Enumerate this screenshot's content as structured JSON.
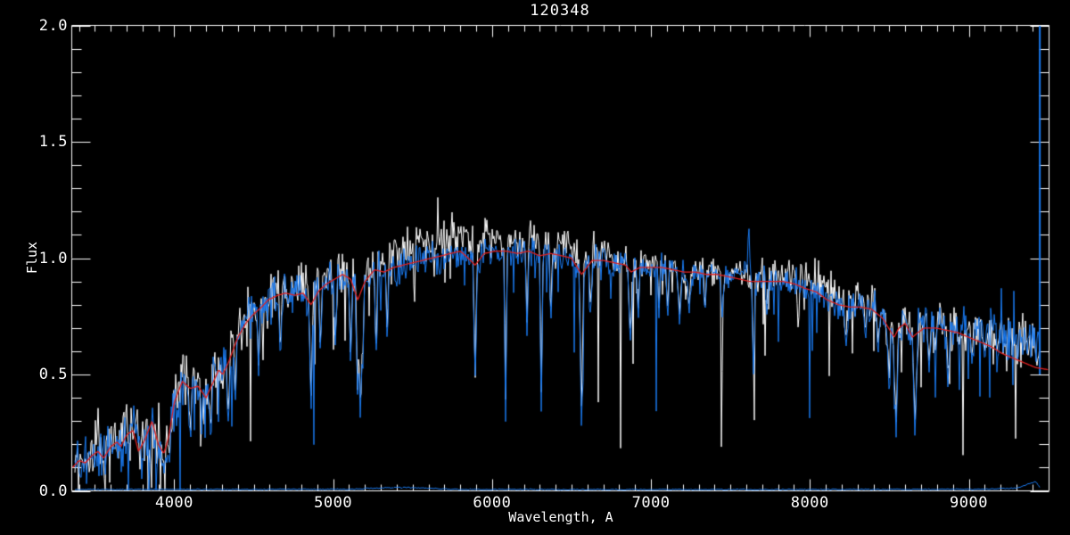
{
  "chart_data": {
    "type": "line",
    "title": "120348",
    "xlabel": "Wavelength, A",
    "ylabel": "Flux",
    "xlim": [
      3355,
      9505
    ],
    "ylim": [
      0.0,
      2.0
    ],
    "x_major_ticks": [
      4000,
      5000,
      6000,
      7000,
      8000,
      9000
    ],
    "x_tick_labels": [
      "4000",
      "5000",
      "6000",
      "7000",
      "8000",
      "9000"
    ],
    "x_minor_step": 100,
    "y_major_ticks": [
      0.0,
      0.5,
      1.0,
      1.5,
      2.0
    ],
    "y_tick_labels": [
      "0.0",
      "0.5",
      "1.0",
      "1.5",
      "2.0"
    ],
    "y_minor_step": 0.1,
    "grid": false,
    "legend": "none",
    "colors": {
      "background": "#000000",
      "axis": "#ffffff",
      "observed_white": "#ffffff",
      "observed_blue": "#1a7af0",
      "model_red": "#e02020"
    },
    "series": [
      {
        "name": "observed-spectrum-white",
        "color": "#ffffff",
        "style": "noisy-histogram"
      },
      {
        "name": "observed-spectrum-blue",
        "color": "#1a7af0",
        "style": "noisy-histogram"
      },
      {
        "name": "model-fit-red",
        "color": "#e02020",
        "style": "smooth-line"
      },
      {
        "name": "error-spectrum-blue",
        "color": "#1a7af0",
        "style": "near-zero-baseline"
      }
    ],
    "continuum_points": [
      [
        3360,
        0.1
      ],
      [
        3400,
        0.13
      ],
      [
        3440,
        0.12
      ],
      [
        3480,
        0.15
      ],
      [
        3520,
        0.17
      ],
      [
        3555,
        0.14
      ],
      [
        3600,
        0.19
      ],
      [
        3640,
        0.21
      ],
      [
        3665,
        0.19
      ],
      [
        3700,
        0.24
      ],
      [
        3740,
        0.26
      ],
      [
        3775,
        0.17
      ],
      [
        3815,
        0.22
      ],
      [
        3860,
        0.3
      ],
      [
        3900,
        0.2
      ],
      [
        3934,
        0.16
      ],
      [
        3965,
        0.23
      ],
      [
        4000,
        0.38
      ],
      [
        4050,
        0.47
      ],
      [
        4101,
        0.44
      ],
      [
        4150,
        0.45
      ],
      [
        4200,
        0.4
      ],
      [
        4240,
        0.46
      ],
      [
        4280,
        0.52
      ],
      [
        4305,
        0.5
      ],
      [
        4340,
        0.55
      ],
      [
        4400,
        0.66
      ],
      [
        4450,
        0.72
      ],
      [
        4500,
        0.76
      ],
      [
        4550,
        0.79
      ],
      [
        4590,
        0.82
      ],
      [
        4650,
        0.84
      ],
      [
        4700,
        0.85
      ],
      [
        4760,
        0.84
      ],
      [
        4810,
        0.85
      ],
      [
        4861,
        0.8
      ],
      [
        4910,
        0.86
      ],
      [
        4960,
        0.89
      ],
      [
        5010,
        0.91
      ],
      [
        5060,
        0.93
      ],
      [
        5110,
        0.91
      ],
      [
        5155,
        0.82
      ],
      [
        5200,
        0.9
      ],
      [
        5260,
        0.95
      ],
      [
        5320,
        0.94
      ],
      [
        5380,
        0.96
      ],
      [
        5440,
        0.97
      ],
      [
        5500,
        0.98
      ],
      [
        5560,
        0.99
      ],
      [
        5620,
        1.0
      ],
      [
        5680,
        1.01
      ],
      [
        5740,
        1.02
      ],
      [
        5800,
        1.03
      ],
      [
        5850,
        1.0
      ],
      [
        5893,
        0.97
      ],
      [
        5950,
        1.02
      ],
      [
        6020,
        1.03
      ],
      [
        6090,
        1.03
      ],
      [
        6160,
        1.02
      ],
      [
        6230,
        1.03
      ],
      [
        6300,
        1.01
      ],
      [
        6370,
        1.02
      ],
      [
        6440,
        1.01
      ],
      [
        6500,
        1.0
      ],
      [
        6563,
        0.93
      ],
      [
        6630,
        0.99
      ],
      [
        6700,
        0.99
      ],
      [
        6770,
        0.98
      ],
      [
        6840,
        0.97
      ],
      [
        6875,
        0.94
      ],
      [
        6930,
        0.96
      ],
      [
        7000,
        0.96
      ],
      [
        7070,
        0.96
      ],
      [
        7140,
        0.95
      ],
      [
        7210,
        0.94
      ],
      [
        7280,
        0.94
      ],
      [
        7350,
        0.93
      ],
      [
        7420,
        0.93
      ],
      [
        7490,
        0.92
      ],
      [
        7560,
        0.91
      ],
      [
        7620,
        0.9
      ],
      [
        7690,
        0.9
      ],
      [
        7760,
        0.9
      ],
      [
        7830,
        0.9
      ],
      [
        7900,
        0.89
      ],
      [
        7970,
        0.87
      ],
      [
        8040,
        0.855
      ],
      [
        8110,
        0.82
      ],
      [
        8180,
        0.8
      ],
      [
        8250,
        0.79
      ],
      [
        8320,
        0.79
      ],
      [
        8390,
        0.78
      ],
      [
        8460,
        0.74
      ],
      [
        8530,
        0.66
      ],
      [
        8560,
        0.7
      ],
      [
        8600,
        0.72
      ],
      [
        8645,
        0.66
      ],
      [
        8680,
        0.68
      ],
      [
        8720,
        0.7
      ],
      [
        8790,
        0.7
      ],
      [
        8860,
        0.69
      ],
      [
        8930,
        0.68
      ],
      [
        9000,
        0.66
      ],
      [
        9070,
        0.64
      ],
      [
        9140,
        0.62
      ],
      [
        9210,
        0.59
      ],
      [
        9280,
        0.57
      ],
      [
        9350,
        0.55
      ],
      [
        9420,
        0.53
      ],
      [
        9505,
        0.52
      ]
    ],
    "noise_sigma_points": [
      [
        3360,
        0.055
      ],
      [
        3700,
        0.06
      ],
      [
        4000,
        0.055
      ],
      [
        4300,
        0.05
      ],
      [
        4600,
        0.045
      ],
      [
        5000,
        0.042
      ],
      [
        5500,
        0.038
      ],
      [
        6000,
        0.032
      ],
      [
        6500,
        0.03
      ],
      [
        7000,
        0.028
      ],
      [
        7500,
        0.028
      ],
      [
        8000,
        0.032
      ],
      [
        8500,
        0.036
      ],
      [
        9000,
        0.042
      ],
      [
        9460,
        0.048
      ]
    ],
    "white_offset_points": [
      [
        3360,
        0.01
      ],
      [
        4400,
        0.015
      ],
      [
        5100,
        0.02
      ],
      [
        5300,
        0.045
      ],
      [
        5500,
        0.07
      ],
      [
        5700,
        0.08
      ],
      [
        5900,
        0.07
      ],
      [
        6100,
        0.06
      ],
      [
        6300,
        0.055
      ],
      [
        6500,
        0.05
      ],
      [
        6700,
        0.03
      ],
      [
        6900,
        0.01
      ],
      [
        7200,
        0.005
      ],
      [
        7600,
        0.015
      ],
      [
        7900,
        0.03
      ],
      [
        8100,
        0.05
      ],
      [
        8300,
        0.04
      ],
      [
        8500,
        0.015
      ],
      [
        8700,
        0.005
      ],
      [
        9000,
        0.0
      ],
      [
        9460,
        0.0
      ]
    ],
    "blue_end_offset_points": [
      [
        3360,
        0
      ],
      [
        8600,
        0
      ],
      [
        8800,
        0.02
      ],
      [
        9000,
        0.04
      ],
      [
        9100,
        0.06
      ],
      [
        9200,
        0.08
      ],
      [
        9300,
        0.09
      ],
      [
        9400,
        0.1
      ],
      [
        9460,
        0.1
      ]
    ],
    "absorption_lines": [
      [
        3934,
        0.05,
        2
      ],
      [
        3968,
        0.1,
        1.5
      ],
      [
        4101,
        0.18,
        2
      ],
      [
        4172,
        0.22,
        1.5
      ],
      [
        4227,
        0.2,
        1.5
      ],
      [
        4340,
        0.25,
        2
      ],
      [
        4383,
        0.3,
        1.5
      ],
      [
        4530,
        0.45,
        1.5
      ],
      [
        4668,
        0.52,
        1.5
      ],
      [
        4861,
        0.3,
        2
      ],
      [
        4920,
        0.55,
        1.5
      ],
      [
        5015,
        0.55,
        1.5
      ],
      [
        5110,
        0.5,
        1.5
      ],
      [
        5155,
        0.33,
        2
      ],
      [
        5172,
        0.2,
        1.5
      ],
      [
        5185,
        0.42,
        1.5
      ],
      [
        5270,
        0.52,
        1.5
      ],
      [
        5340,
        0.6,
        1.5
      ],
      [
        5893,
        0.45,
        2
      ],
      [
        6085,
        0.27,
        1.5
      ],
      [
        6220,
        0.65,
        1.5
      ],
      [
        6310,
        0.3,
        1.5
      ],
      [
        6370,
        0.68,
        1.5
      ],
      [
        6563,
        0.2,
        2
      ],
      [
        6620,
        0.7,
        1.5
      ],
      [
        6870,
        0.6,
        2.5
      ],
      [
        6920,
        0.72,
        1.5
      ],
      [
        7050,
        0.74,
        1.5
      ],
      [
        7105,
        0.7,
        1.5
      ],
      [
        7180,
        0.7,
        2.5
      ],
      [
        7240,
        0.72,
        2
      ],
      [
        7340,
        0.72,
        1.5
      ],
      [
        7450,
        0.7,
        1.5
      ],
      [
        7645,
        0.45,
        1.5
      ],
      [
        7730,
        0.72,
        1.5
      ],
      [
        8227,
        0.58,
        2
      ],
      [
        8350,
        0.6,
        1.5
      ],
      [
        8430,
        0.58,
        1.5
      ],
      [
        8498,
        0.42,
        2
      ],
      [
        8542,
        0.2,
        2.5
      ],
      [
        8662,
        0.18,
        2.5
      ],
      [
        8750,
        0.48,
        2
      ],
      [
        8790,
        0.52,
        1.5
      ],
      [
        8870,
        0.42,
        2
      ],
      [
        8940,
        0.55,
        1.5
      ],
      [
        9020,
        0.5,
        2
      ],
      [
        9100,
        0.52,
        1.5
      ],
      [
        9180,
        0.55,
        1.5
      ]
    ],
    "emission_spikes": [
      [
        7590,
        1.0,
        1.5
      ],
      [
        7615,
        1.15,
        2
      ]
    ],
    "edge_spike": {
      "wavelength": 9447,
      "flux_from": 0.5,
      "flux_to": 2.0
    },
    "error_line_points": [
      [
        3380,
        0.006
      ],
      [
        5100,
        0.007
      ],
      [
        5250,
        0.012
      ],
      [
        5450,
        0.014
      ],
      [
        5600,
        0.012
      ],
      [
        5750,
        0.007
      ],
      [
        6500,
        0.006
      ],
      [
        8000,
        0.006
      ],
      [
        9100,
        0.007
      ],
      [
        9300,
        0.012
      ],
      [
        9380,
        0.03
      ],
      [
        9420,
        0.04
      ],
      [
        9445,
        0.015
      ]
    ],
    "noise_seed_white": 77,
    "noise_seed_blue": 1234
  }
}
